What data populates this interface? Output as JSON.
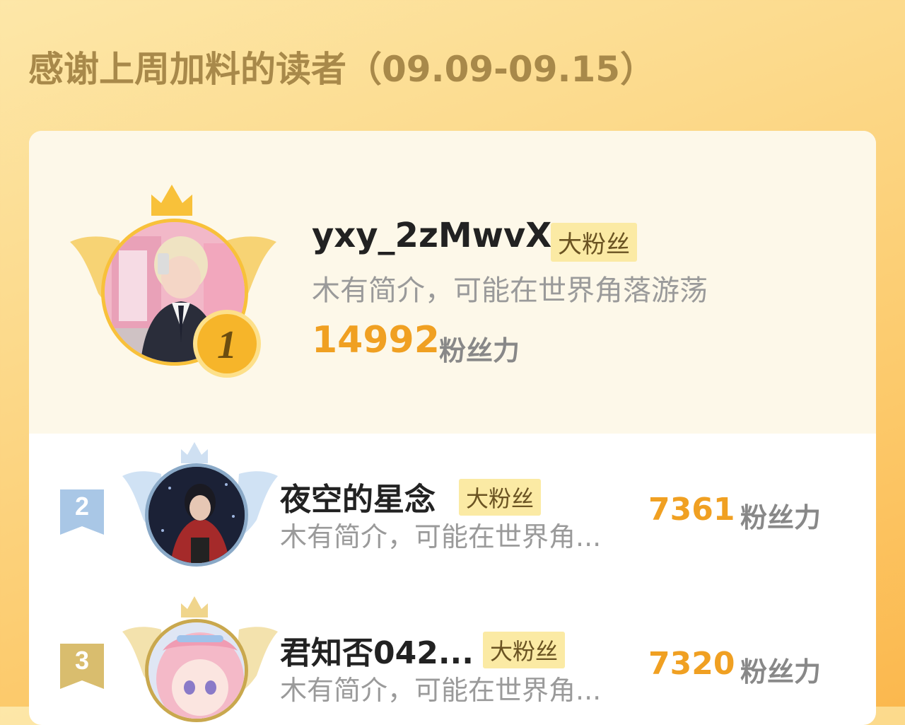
{
  "header": {
    "title": "感谢上周加料的读者（09.09-09.15）"
  },
  "colors": {
    "score": "#f0a022",
    "badge_bg": "#fbeaa4",
    "gold": "#f8c13a",
    "silver": "#a9c7e6",
    "bronze": "#d9bd6e"
  },
  "ranking": {
    "first": {
      "rank": "1",
      "name": "yxy_2zMwvX",
      "badge": "大粉丝",
      "bio": "木有简介，可能在世界角落游荡",
      "score": "14992",
      "unit": "粉丝力",
      "icons": [
        "crown-icon",
        "wings-icon",
        "gold-medal-icon"
      ]
    },
    "list": [
      {
        "rank": "2",
        "name": "夜空的星念",
        "badge": "大粉丝",
        "bio": "木有简介，可能在世界角...",
        "score": "7361",
        "unit": "粉丝力"
      },
      {
        "rank": "3",
        "name": "君知否042...",
        "badge": "大粉丝",
        "bio": "木有简介，可能在世界角...",
        "score": "7320",
        "unit": "粉丝力"
      }
    ]
  }
}
